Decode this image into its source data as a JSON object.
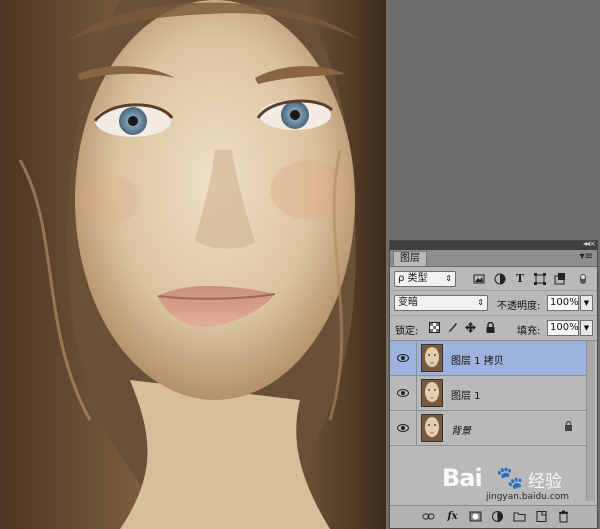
{
  "panel": {
    "tab_label": "图层",
    "collapse_glyph": "◂◂",
    "close_glyph": "×",
    "menu_glyph": "▾≡",
    "filter": {
      "label": "ρ 类型",
      "arrow": "⇕"
    },
    "filter_icons": [
      "image-filter-icon",
      "adjustment-filter-icon",
      "type-filter-icon",
      "shape-filter-icon",
      "smart-object-filter-icon"
    ],
    "blend_mode": "变暗",
    "opacity_label": "不透明度:",
    "opacity_value": "100%",
    "lock_label": "锁定:",
    "fill_label": "填充:",
    "fill_value": "100%",
    "layers": [
      {
        "name": "图层 1 拷贝",
        "selected": true,
        "italic": false,
        "locked": false
      },
      {
        "name": "图层 1",
        "selected": false,
        "italic": false,
        "locked": false
      },
      {
        "name": "背景",
        "selected": false,
        "italic": true,
        "locked": true
      }
    ]
  },
  "watermark": {
    "brand": "Bai",
    "paw": "🐾",
    "jingyan": "经验",
    "url": "jingyan.baidu.com"
  },
  "colors": {
    "workspace": "#6e6e6e",
    "panel": "#b9b9b9",
    "selected_layer": "#9db2dc"
  }
}
